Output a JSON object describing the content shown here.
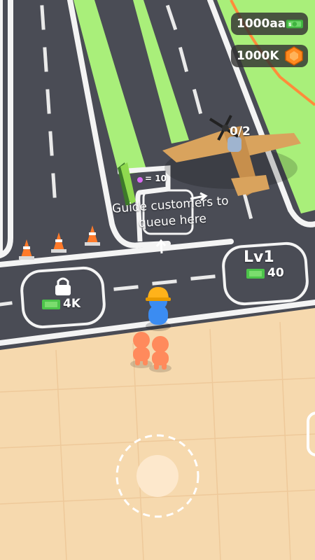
{
  "hud": {
    "cash_value": "1000aa",
    "cash_icon": "cash-bill-icon",
    "gems_value": "1000K",
    "gems_icon": "hexagon-gem-icon"
  },
  "plane": {
    "passengers": "0/2"
  },
  "queue_sign": {
    "rate_text": "= 10",
    "icon": "gem-icon"
  },
  "tutorial": {
    "line1": "Guide customers to",
    "line2": "queue here"
  },
  "locked_zone": {
    "price": "4K",
    "icon": "lock-icon"
  },
  "upgrade_zone": {
    "level": "Lv1",
    "price": "40"
  },
  "colors": {
    "runway": "#4a4c55",
    "grass": "#a9ef7a",
    "sand": "#f6d9ae",
    "player_shirt": "#3b8cf2",
    "helmet": "#ffb21a",
    "customer": "#ff8a5c"
  }
}
